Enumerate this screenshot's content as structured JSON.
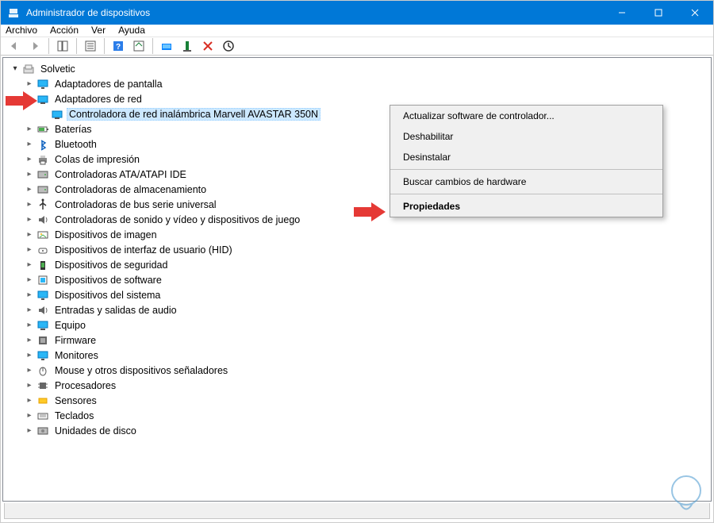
{
  "window": {
    "title": "Administrador de dispositivos"
  },
  "menubar": [
    "Archivo",
    "Acción",
    "Ver",
    "Ayuda"
  ],
  "tree": {
    "root": "Solvetic",
    "nodes": [
      {
        "label": "Adaptadores de pantalla",
        "open": false
      },
      {
        "label": "Adaptadores de red",
        "open": true,
        "children": [
          {
            "label": "Controladora de red inalámbrica Marvell AVASTAR 350N",
            "selected": true
          }
        ]
      },
      {
        "label": "Baterías",
        "open": false
      },
      {
        "label": "Bluetooth",
        "open": false
      },
      {
        "label": "Colas de impresión",
        "open": false
      },
      {
        "label": "Controladoras ATA/ATAPI IDE",
        "open": false
      },
      {
        "label": "Controladoras de almacenamiento",
        "open": false
      },
      {
        "label": "Controladoras de bus serie universal",
        "open": false
      },
      {
        "label": "Controladoras de sonido y vídeo y dispositivos de juego",
        "open": false
      },
      {
        "label": "Dispositivos de imagen",
        "open": false
      },
      {
        "label": "Dispositivos de interfaz de usuario (HID)",
        "open": false
      },
      {
        "label": "Dispositivos de seguridad",
        "open": false
      },
      {
        "label": "Dispositivos de software",
        "open": false
      },
      {
        "label": "Dispositivos del sistema",
        "open": false
      },
      {
        "label": "Entradas y salidas de audio",
        "open": false
      },
      {
        "label": "Equipo",
        "open": false
      },
      {
        "label": "Firmware",
        "open": false
      },
      {
        "label": "Monitores",
        "open": false
      },
      {
        "label": "Mouse y otros dispositivos señaladores",
        "open": false
      },
      {
        "label": "Procesadores",
        "open": false
      },
      {
        "label": "Sensores",
        "open": false
      },
      {
        "label": "Teclados",
        "open": false
      },
      {
        "label": "Unidades de disco",
        "open": false
      }
    ]
  },
  "contextmenu": {
    "items": [
      {
        "label": "Actualizar software de controlador..."
      },
      {
        "label": "Deshabilitar"
      },
      {
        "label": "Desinstalar"
      },
      {
        "sep": true
      },
      {
        "label": "Buscar cambios de hardware"
      },
      {
        "sep": true
      },
      {
        "label": "Propiedades",
        "bold": true
      }
    ]
  }
}
